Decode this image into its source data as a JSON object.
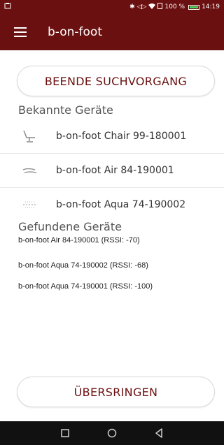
{
  "status_bar": {
    "icons": [
      "notification-icon",
      "bluetooth-icon",
      "vibrate-icon",
      "wifi-icon",
      "battery-saver-icon",
      "battery-icon"
    ],
    "battery": "100 %",
    "time": "14:19"
  },
  "app_bar": {
    "menu_icon": "hamburger-menu-icon",
    "title": "b-on-foot"
  },
  "buttons": {
    "stop_search": "BEENDE SUCHVORGANG",
    "skip": "ÜBERSRINGEN"
  },
  "known_devices": {
    "title": "Bekannte Geräte",
    "items": [
      {
        "label": "b-on-foot Chair 99-180001",
        "icon": "chair-icon"
      },
      {
        "label": "b-on-foot Air 84-190001",
        "icon": "air-icon"
      },
      {
        "label": "b-on-foot Aqua 74-190002",
        "icon": "aqua-icon"
      }
    ]
  },
  "found_devices": {
    "title": "Gefundene Geräte",
    "items": [
      "b-on-foot Air 84-190001 (RSSI: -70)",
      "b-on-foot Aqua 74-190002 (RSSI: -68)",
      "b-on-foot Aqua 74-190001 (RSSI: -100)"
    ]
  },
  "nav_bar": {
    "icons": [
      "recents-square-icon",
      "home-circle-icon",
      "back-triangle-icon"
    ]
  },
  "colors": {
    "primary": "#6b1010",
    "accent_text": "#6b1010",
    "nav_background": "#111111"
  }
}
